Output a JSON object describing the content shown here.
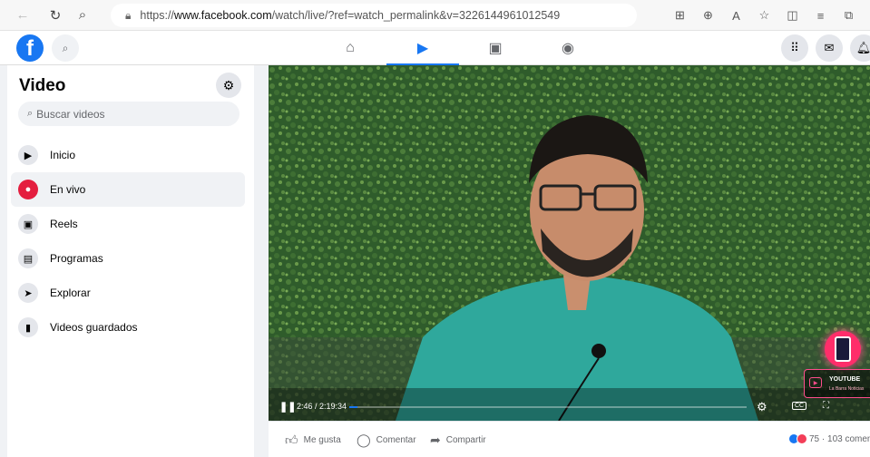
{
  "browser": {
    "url_prefix": "https://",
    "url_host": "www.facebook.com",
    "url_path": "/watch/live/?ref=watch_permalink&v=3226144961012549",
    "icons": [
      "split-screen-icon",
      "zoom-icon",
      "read-aloud-icon",
      "favorite-icon",
      "sidebar-icon",
      "favorites-list-icon",
      "collections-icon"
    ]
  },
  "header": {
    "logo": "f",
    "tabs": [
      {
        "name": "home-icon",
        "glyph": "⌂"
      },
      {
        "name": "watch-icon",
        "glyph": "▶"
      },
      {
        "name": "marketplace-icon",
        "glyph": "▣"
      },
      {
        "name": "gaming-icon",
        "glyph": "◉"
      }
    ],
    "active_tab": 1
  },
  "sidebar": {
    "title": "Video",
    "search_placeholder": "Buscar videos",
    "items": [
      {
        "label": "Inicio",
        "icon": "video-home-icon",
        "glyph": "▶"
      },
      {
        "label": "En vivo",
        "icon": "live-icon",
        "glyph": "●"
      },
      {
        "label": "Reels",
        "icon": "reels-icon",
        "glyph": "▣"
      },
      {
        "label": "Programas",
        "icon": "shows-icon",
        "glyph": "▤"
      },
      {
        "label": "Explorar",
        "icon": "explore-icon",
        "glyph": "➤"
      },
      {
        "label": "Videos guardados",
        "icon": "bookmark-icon",
        "glyph": "▮"
      }
    ],
    "active_item": 1
  },
  "video": {
    "timecode": "2:46 / 2:19:34",
    "progress": 0.02,
    "overlay_title": "YOUTUBE",
    "overlay_sub": "La Barra Noticias"
  },
  "actions": {
    "like": "Me gusta",
    "comment": "Comentar",
    "share": "Compartir",
    "reactions_text": "75 · 103 comen"
  },
  "colors": {
    "accent": "#1877f2",
    "live": "#e41e3f"
  }
}
